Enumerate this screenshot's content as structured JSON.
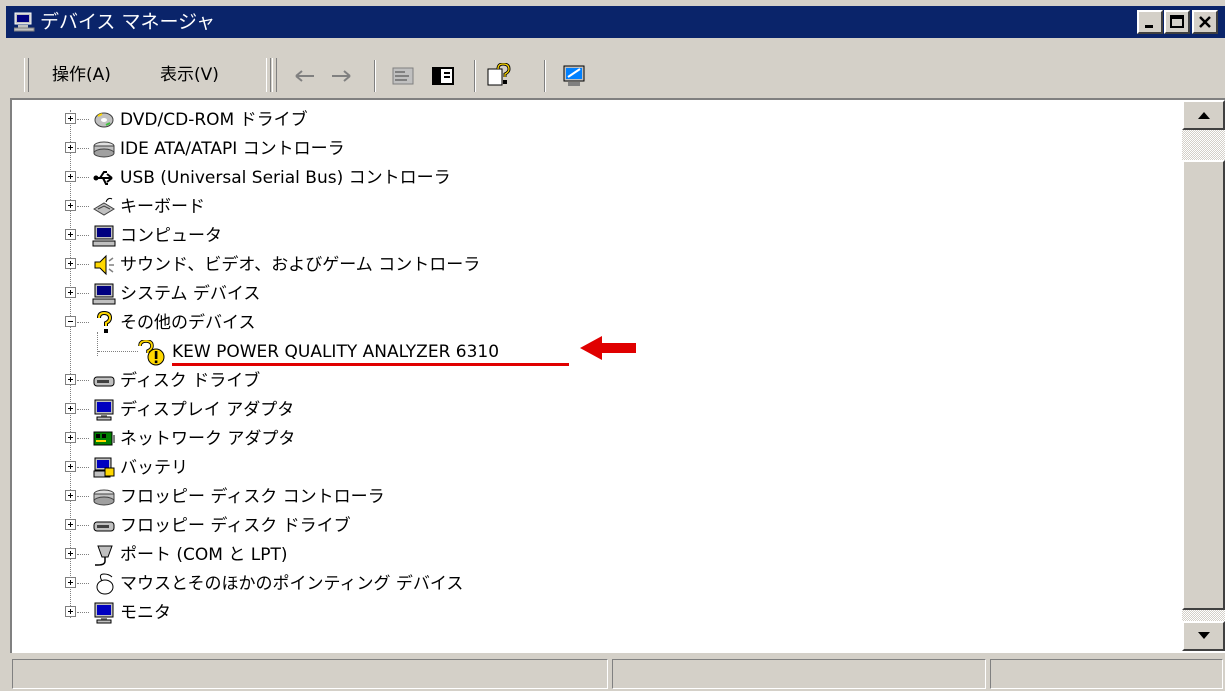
{
  "window": {
    "title": "デバイス マネージャ",
    "controls": [
      "minimize",
      "maximize",
      "close"
    ]
  },
  "menubar": {
    "items": [
      {
        "label": "操作(A)"
      },
      {
        "label": "表示(V)"
      }
    ],
    "toolbar_icons": [
      "back-arrow-icon",
      "forward-arrow-icon",
      "properties-icon",
      "details-pane-icon",
      "help-icon",
      "scan-hardware-icon"
    ]
  },
  "tree": {
    "nodes": [
      {
        "label": "DVD/CD-ROM ドライブ",
        "icon": "dvd-drive-icon",
        "expanded": false
      },
      {
        "label": "IDE ATA/ATAPI コントローラ",
        "icon": "ide-controller-icon",
        "expanded": false
      },
      {
        "label": "USB (Universal Serial Bus) コントローラ",
        "icon": "usb-icon",
        "expanded": false
      },
      {
        "label": "キーボード",
        "icon": "keyboard-icon",
        "expanded": false
      },
      {
        "label": "コンピュータ",
        "icon": "computer-icon",
        "expanded": false
      },
      {
        "label": "サウンド、ビデオ、およびゲーム コントローラ",
        "icon": "speaker-icon",
        "expanded": false
      },
      {
        "label": "システム デバイス",
        "icon": "system-device-icon",
        "expanded": false
      },
      {
        "label": "その他のデバイス",
        "icon": "unknown-device-icon",
        "expanded": true,
        "children": [
          {
            "label": "KEW POWER QUALITY ANALYZER 6310",
            "icon": "warning-device-icon"
          }
        ]
      },
      {
        "label": "ディスク ドライブ",
        "icon": "disk-drive-icon",
        "expanded": false
      },
      {
        "label": "ディスプレイ アダプタ",
        "icon": "display-adapter-icon",
        "expanded": false
      },
      {
        "label": "ネットワーク アダプタ",
        "icon": "network-adapter-icon",
        "expanded": false
      },
      {
        "label": "バッテリ",
        "icon": "battery-icon",
        "expanded": false
      },
      {
        "label": "フロッピー ディスク コントローラ",
        "icon": "floppy-controller-icon",
        "expanded": false
      },
      {
        "label": "フロッピー ディスク ドライブ",
        "icon": "floppy-drive-icon",
        "expanded": false
      },
      {
        "label": "ポート (COM と LPT)",
        "icon": "port-icon",
        "expanded": false
      },
      {
        "label": "マウスとそのほかのポインティング デバイス",
        "icon": "mouse-icon",
        "expanded": false
      },
      {
        "label": "モニタ",
        "icon": "monitor-icon",
        "expanded": false
      }
    ]
  },
  "annotation": {
    "highlight_color": "#e00000",
    "highlighted_item": "KEW POWER QUALITY ANALYZER 6310"
  },
  "statusbar": {
    "panes": [
      "",
      "",
      ""
    ]
  }
}
